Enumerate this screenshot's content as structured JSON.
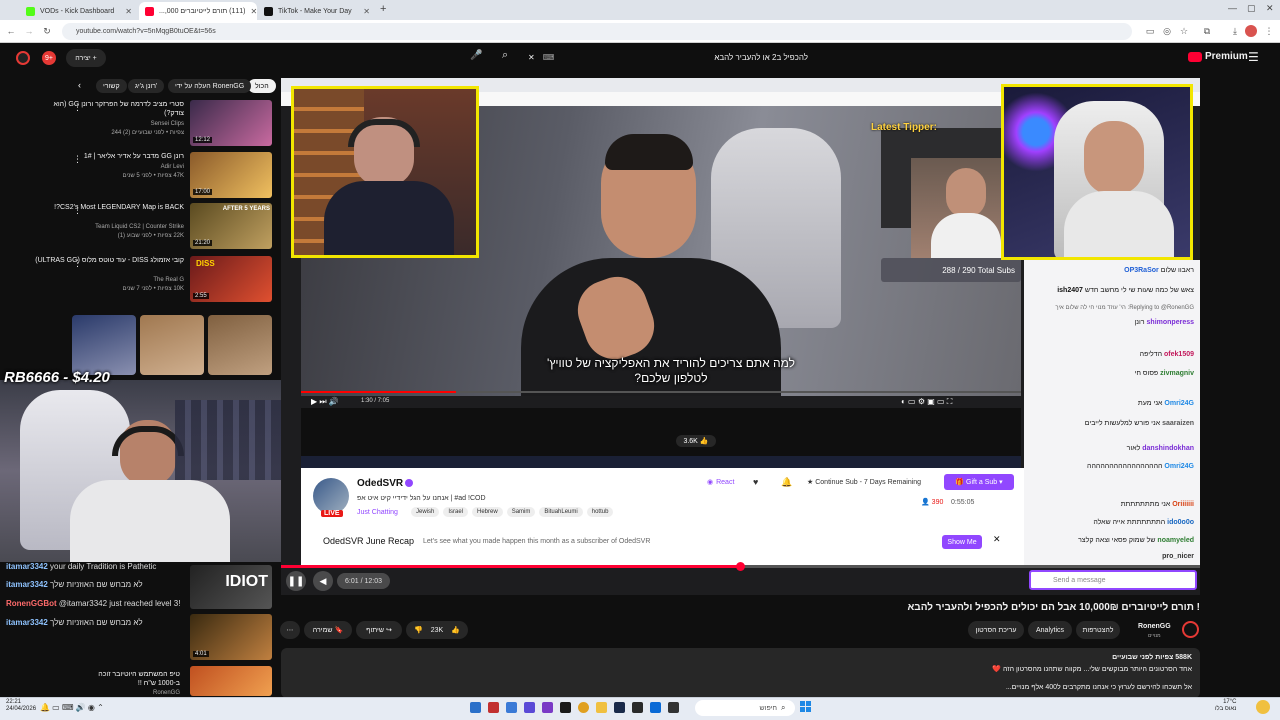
{
  "browser": {
    "tabs": [
      {
        "title": "VODs - Kick Dashboard",
        "color": "#53fc18"
      },
      {
        "title": "(111) תורם לייטיוברים 000,...",
        "color": "#ff0033"
      },
      {
        "title": "TikTok - Make Your Day",
        "color": "#111111"
      }
    ],
    "url": "youtube.com/watch?v=5nMqgB0tuOE&t=56s"
  },
  "youtube": {
    "search_query": "להכפיל ב2 או להעביר להבא",
    "create_label": "יצירה",
    "premium_label": "Premium",
    "notif_count": "9+",
    "chips": [
      "הכול",
      "העלה על ידי RonenGG",
      "רונן ג'יג'",
      "קשורי"
    ],
    "related": [
      {
        "title": "סטרי מציב לדרמה של הפרזקר ורונן GG (הוא צודק?)",
        "channel": "Sensei Clips",
        "meta": "צפיות • לפני שבועיים (2) 244",
        "duration": "12:12"
      },
      {
        "title": "רונן GG מדבר על אדיר אליאר | 1#",
        "channel": "Adir Levi",
        "meta": "47K צפיות • לפני 5 שנים",
        "duration": "17:00"
      },
      {
        "title": "CS2's Most LEGENDARY Map is BACK?!",
        "channel": "Team Liquid CS2 | Counter Strike",
        "meta": "22K צפיות • לפני שבוע (1)",
        "duration": "21:20"
      },
      {
        "title": "קובי אזמולג DISS - עוד טוטס מלוס (ULTRAS GG)",
        "channel": "The Real G",
        "meta": "10K צפיות • לפני 7 שנים",
        "duration": "2:55"
      },
      {
        "title": "טיפ המשתמש היוטיובר זוכה ב-1000 ש\"ח !!",
        "channel": "RonenGG",
        "meta": "",
        "duration": "4:01"
      }
    ],
    "video_title": "! תורם לייטיוברים 10,000₪ אבל הם יכולים להכפיל ולהעביר להבא",
    "channel_name": "RonenGG",
    "channel_subs": "מנויים",
    "like_count": "23K",
    "share_label": "שיתוף",
    "save_label": "שמירה",
    "analytics_label": "Analytics",
    "edit_label": "עריכת הסרטון",
    "promote_label": "להצטרפות",
    "views": "588K צפיות לפני שבועיים",
    "description": "אחד הסרטונים היותר מבוקשים שלי... מקווה שתהנו מהסרטון הזה ❤️",
    "description2": "אל תשכחו להירשם לערוץ כי אנחנו מתקרבים ל400 אלף מנויים..."
  },
  "stream": {
    "donation_overlay": "RB6666 - $4.20",
    "streamer_name": "OdedSVR",
    "stream_title": "אנחנו על הגל ידידיי קיט איט אפ | #ad !COD",
    "category": "Just Chatting",
    "tags": [
      "Jewish",
      "Israel",
      "Hebrew",
      "Samim",
      "BituahLeumi",
      "hottub"
    ],
    "react_label": "React",
    "continue_sub_label": "Continue Sub - 7 Days Remaining",
    "gift_label": "Gift a Sub",
    "viewers": "390",
    "uptime": "0:55:05",
    "recap_title": "OdedSVR June Recap",
    "recap_text": "Let's see what you made happen this month as a subscriber of OdedSVR",
    "show_me_label": "Show Me",
    "live_label": "LIVE",
    "player_time": "6:01 / 12:03",
    "caption_line1": "למה אתם צריכים להוריד את האפליקציה של טוויץ'",
    "caption_line2": "לטלפון שלכם?",
    "latest_tipper": "Latest Tipper:",
    "sub_goal": "288 / 290 Total Subs",
    "inner_time": "1:30 / 7:05",
    "inner_likes": "3.6K"
  },
  "chat": [
    {
      "user": "OP3RaSor",
      "text": "ראבוו שלום",
      "color": "#1f5fd6"
    },
    {
      "user": "ish2407",
      "text": "צאש של כמה שעות שי לי מחשב חדש",
      "color": "#111111"
    },
    {
      "user": "RonenGG",
      "text": "Replying to @RonenGG: הי' עוזד מנוי חי לה שלום איך",
      "color": "#6b2bd9"
    },
    {
      "user": "shimonperess",
      "text": "רונן",
      "color": "#7b2ed6"
    },
    {
      "user": "ofek1509",
      "text": "הדליפה",
      "color": "#c2185b"
    },
    {
      "user": "zivmagniv",
      "text": "פסוס חי",
      "color": "#2e7d32"
    },
    {
      "user": "Omri24G",
      "text": "אני מעת",
      "color": "#1e88e5"
    },
    {
      "user": "saaraizen",
      "text": "אני פורש למלעשות לייבים",
      "color": "#555555"
    },
    {
      "user": "danshindokhan",
      "text": "לאור",
      "color": "#7b2ed6"
    },
    {
      "user": "Omri24G",
      "text": "ההההההההההההההההה",
      "color": "#1e88e5"
    },
    {
      "user": "Oriiiiiii",
      "text": "אני מתתתתתתת",
      "color": "#d84315"
    },
    {
      "user": "ido0o0o",
      "text": "התתתתתתת אייה שאלה",
      "color": "#1565c0"
    },
    {
      "user": "noamyeled",
      "text": "של שמוק פסאי וצאה קלצר",
      "color": "#2e7d32"
    },
    {
      "user": "pro_nicer",
      "text": "",
      "color": "#333333"
    }
  ],
  "chat_input_placeholder": "Send a message",
  "left_chat": [
    {
      "user": "itamar3342",
      "text": "your daily Tradition is Pathetic"
    },
    {
      "user": "itamar3342",
      "text": "לא מבחש שם האוזניות שלך"
    },
    {
      "user": "RonenGGBot",
      "text": "@itamar3342 just reached level 3!"
    },
    {
      "user": "itamar3342",
      "text": "לא מבחש שם האוזניות שלך"
    }
  ],
  "taskbar": {
    "time": "22:21",
    "date": "24/04/2026",
    "weather": "17°C",
    "weather_desc": "נאוס בלו",
    "search_placeholder": "חיפוש"
  }
}
